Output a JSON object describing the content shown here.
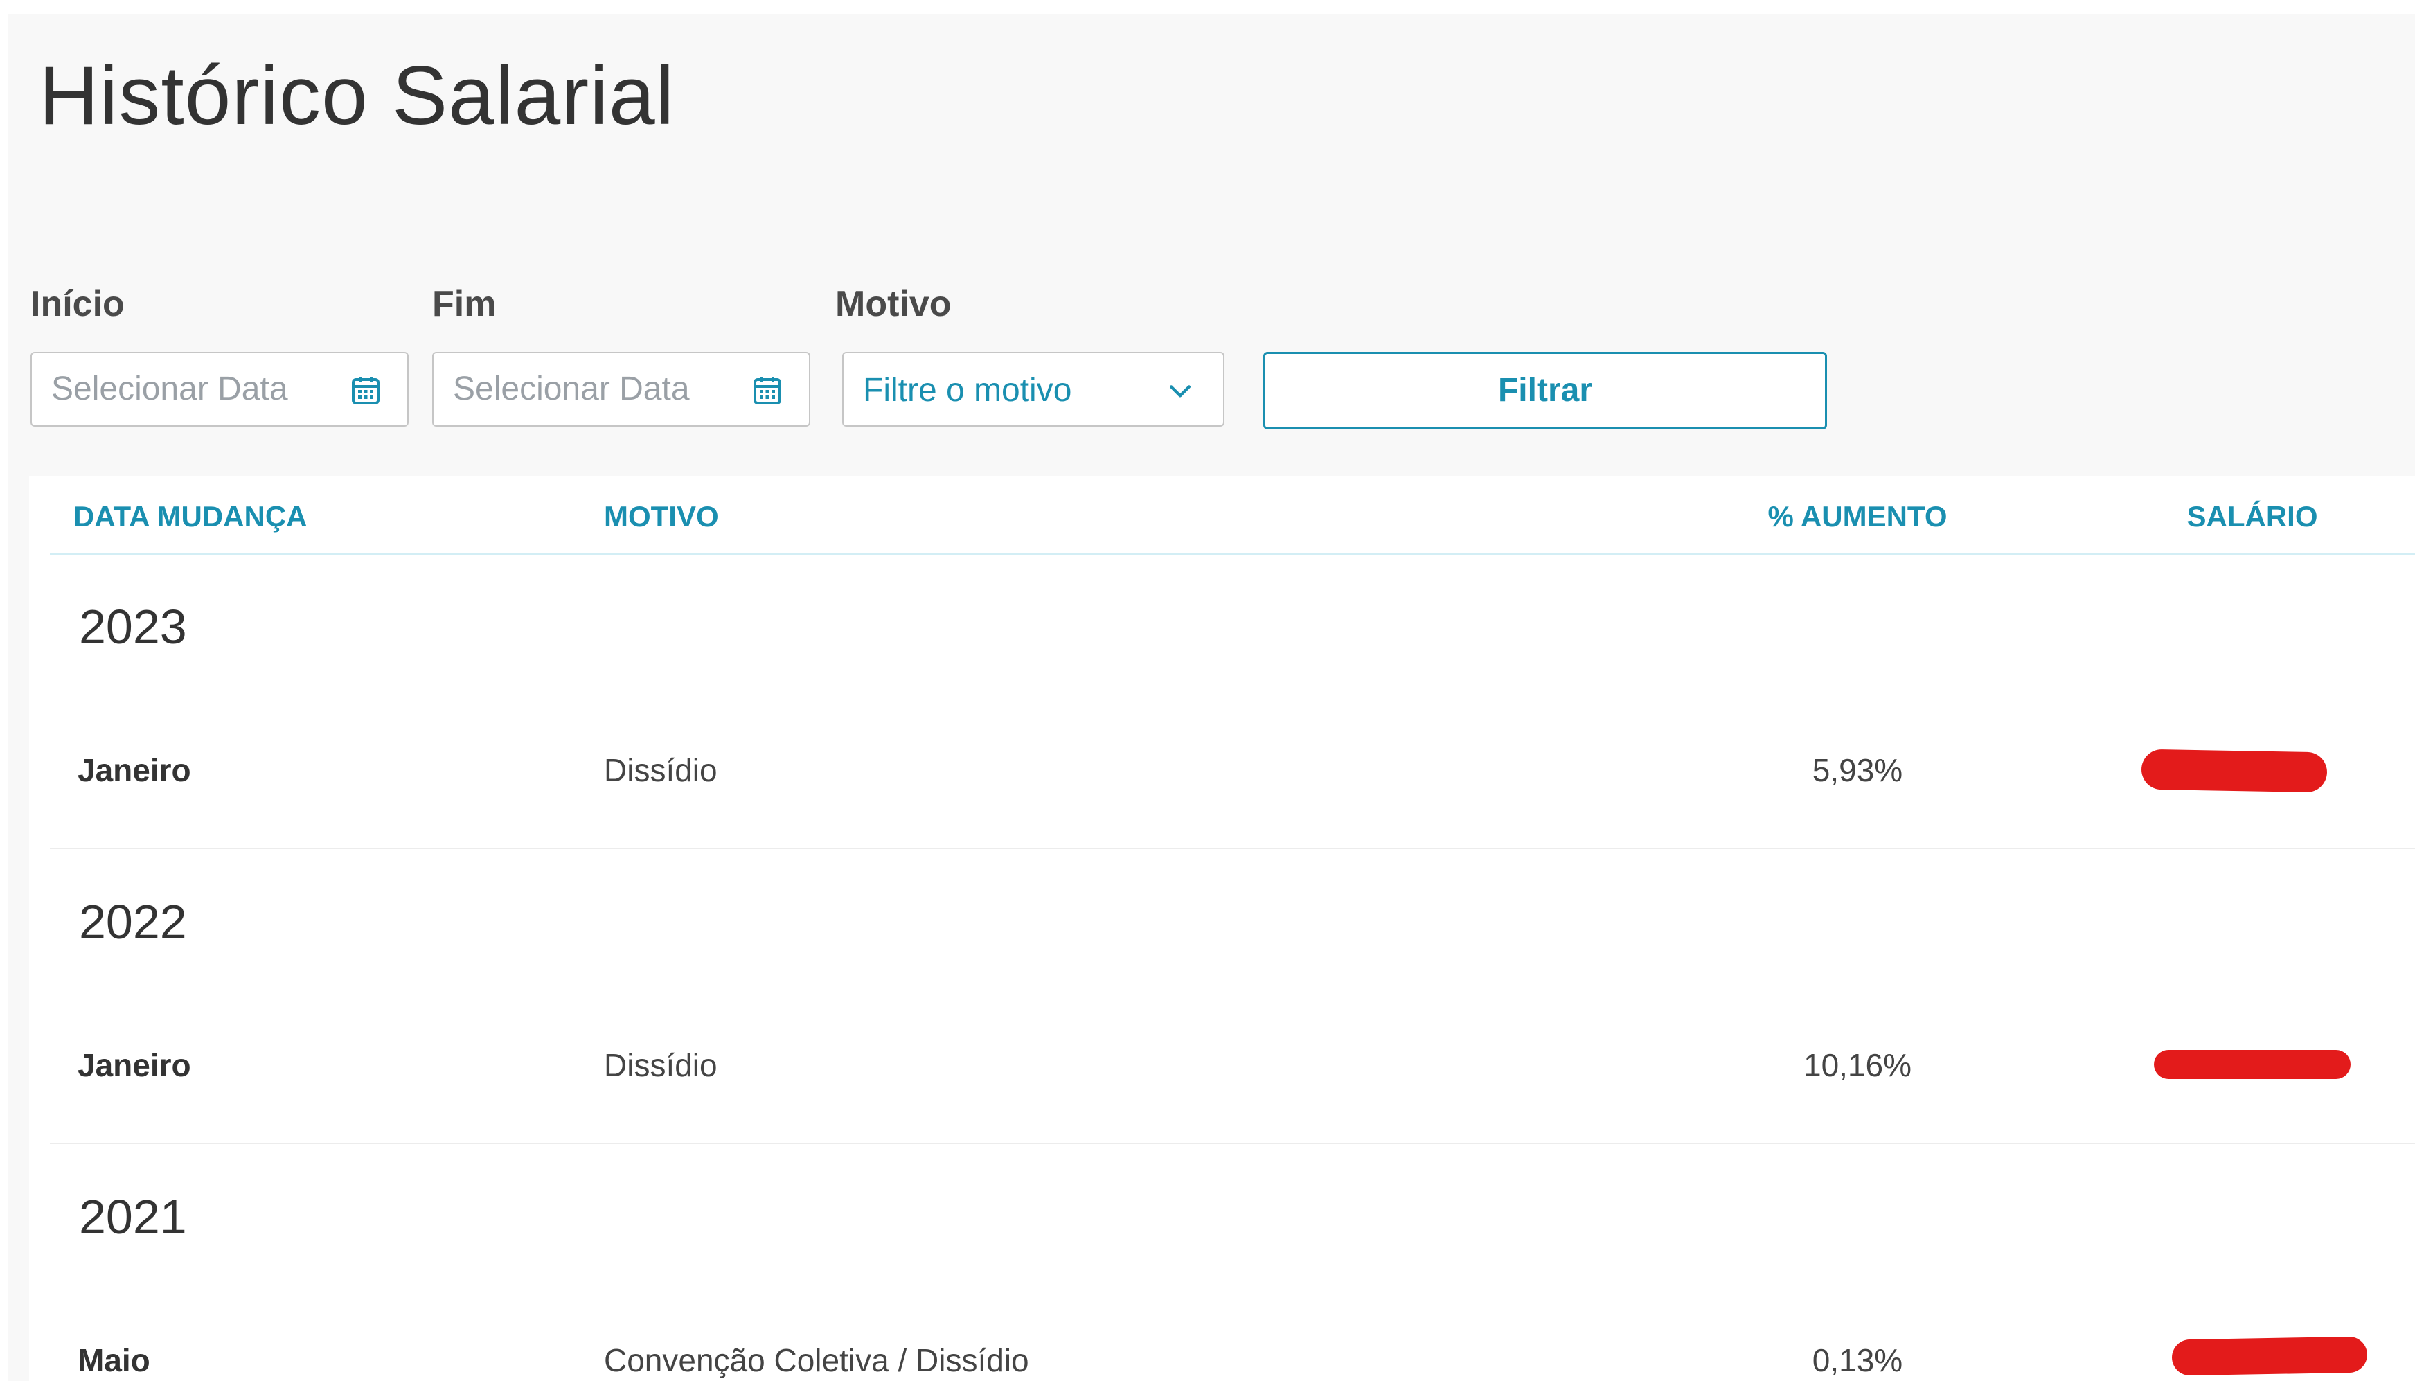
{
  "page": {
    "title": "Histórico Salarial"
  },
  "filters": {
    "start": {
      "label": "Início",
      "placeholder": "Selecionar Data",
      "icon": "calendar-icon"
    },
    "end": {
      "label": "Fim",
      "placeholder": "Selecionar Data",
      "icon": "calendar-icon"
    },
    "reason": {
      "label": "Motivo",
      "value": "Filtre o motivo",
      "icon": "chevron-down-icon"
    },
    "submit_label": "Filtrar"
  },
  "table": {
    "headers": [
      "DATA MUDANÇA",
      "MOTIVO",
      "% AUMENTO",
      "SALÁRIO"
    ],
    "groups": [
      {
        "year": "2023",
        "rows": [
          {
            "month": "Janeiro",
            "reason": "Dissídio",
            "increase": "5,93%",
            "salary": "",
            "salary_redacted": true
          }
        ]
      },
      {
        "year": "2022",
        "rows": [
          {
            "month": "Janeiro",
            "reason": "Dissídio",
            "increase": "10,16%",
            "salary": "",
            "salary_redacted": true
          }
        ]
      },
      {
        "year": "2021",
        "rows": [
          {
            "month": "Maio",
            "reason": "Convenção Coletiva / Dissídio",
            "increase": "0,13%",
            "salary": "",
            "salary_redacted": true
          }
        ]
      }
    ]
  },
  "colors": {
    "accent": "#1a8fb0",
    "redaction": "#e31b1b",
    "panel_background": "#f8f8f8"
  }
}
